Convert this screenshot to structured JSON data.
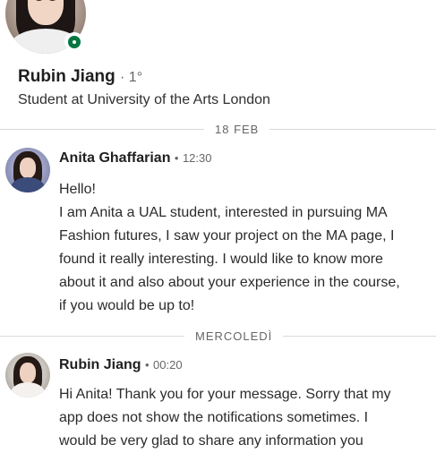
{
  "profile": {
    "name": "Rubin Jiang",
    "degree": "· 1°",
    "headline": "Student at University of the Arts London",
    "status": "online"
  },
  "dividers": {
    "first": "18 FEB",
    "second": "MERCOLEDÌ"
  },
  "messages": [
    {
      "sender": "Anita Ghaffarian",
      "separator": "•",
      "time": "12:30",
      "lines": [
        "Hello!",
        "I am Anita a UAL student, interested in pursuing MA",
        "Fashion futures, I saw your project on the MA page, I",
        "found it really interesting. I would like to know more",
        "about it and also about your experience in the course,",
        "if you would be up to!"
      ]
    },
    {
      "sender": "Rubin Jiang",
      "separator": "•",
      "time": "00:20",
      "lines": [
        "Hi Anita! Thank you for your message. Sorry that my",
        "app does not show the notifications sometimes. I",
        "would be very glad to share any information you"
      ]
    }
  ],
  "colors": {
    "online": "#057642",
    "divider": "#d9d9d9",
    "muted_text": "#666666"
  }
}
